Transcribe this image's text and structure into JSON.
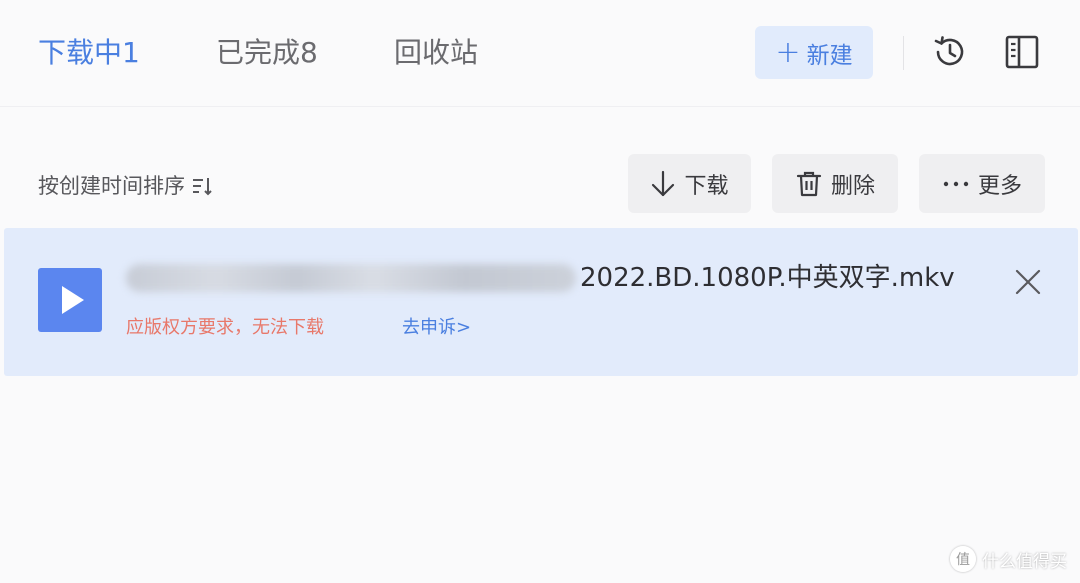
{
  "tabs": [
    {
      "label": "下载中1",
      "active": true
    },
    {
      "label": "已完成8",
      "active": false
    },
    {
      "label": "回收站",
      "active": false
    }
  ],
  "toolbar": {
    "new_label": "新建",
    "history_icon": "history-clock-icon",
    "panel_icon": "side-panel-icon"
  },
  "list_toolbar": {
    "sort_label": "按创建时间排序",
    "download_label": "下载",
    "delete_label": "删除",
    "more_label": "更多"
  },
  "file": {
    "name_visible": "2022.BD.1080P.中英双字.mkv",
    "error_text": "应版权方要求，无法下载",
    "appeal_text": "去申诉>"
  },
  "watermark": {
    "logo_text": "值",
    "text": "什么值得买"
  },
  "colors": {
    "accent": "#4a7fe0",
    "error": "#e8786a",
    "row_highlight": "#e2ebfb",
    "thumb": "#5b86ef"
  }
}
